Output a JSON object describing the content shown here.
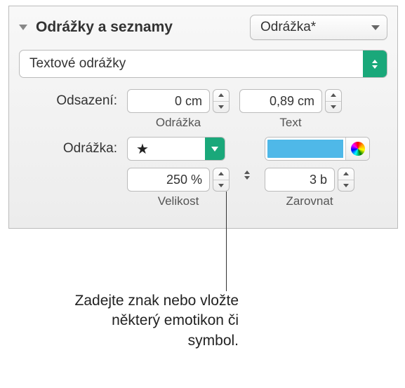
{
  "header": {
    "title": "Odrážky a seznamy",
    "style_popup": "Odrážka*"
  },
  "type_popup": "Textové odrážky",
  "indent": {
    "label": "Odsazení:",
    "bullet_value": "0 cm",
    "bullet_caption": "Odrážka",
    "text_value": "0,89 cm",
    "text_caption": "Text"
  },
  "bullet": {
    "label": "Odrážka:",
    "glyph": "★"
  },
  "size": {
    "value": "250 %",
    "caption": "Velikost"
  },
  "align": {
    "value": "3 b",
    "caption": "Zarovnat"
  },
  "callout": "Zadejte znak nebo vložte některý emotikon či symbol."
}
